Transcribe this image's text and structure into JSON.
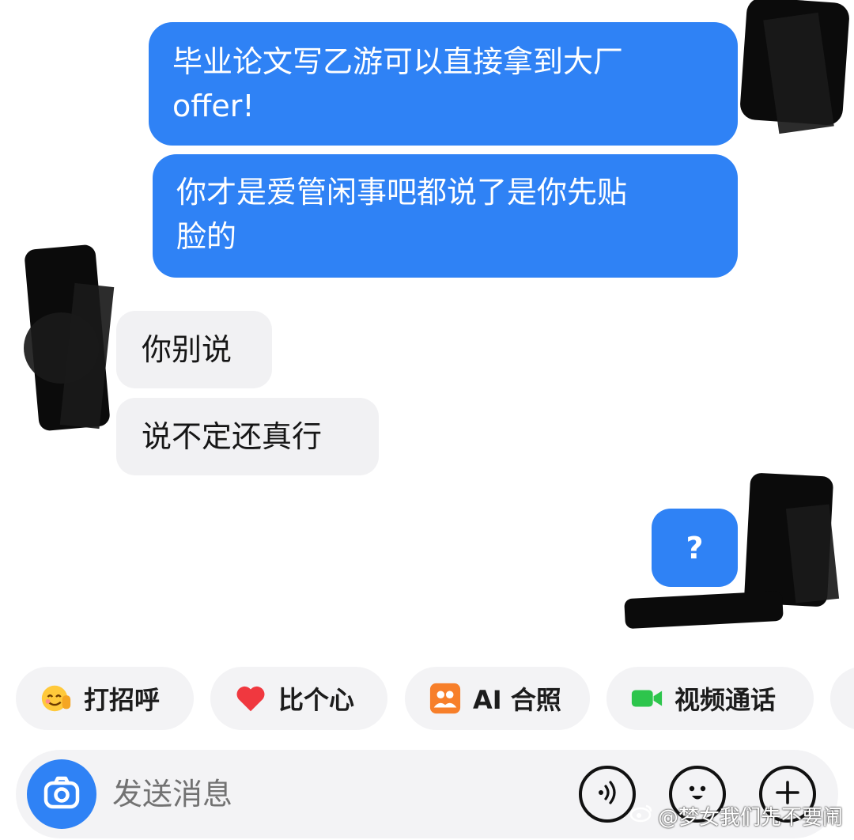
{
  "messages": [
    {
      "id": "msg1",
      "side": "sent",
      "lines": [
        "毕业论文写乙游可以直接拿到大厂",
        "offer!"
      ]
    },
    {
      "id": "msg2",
      "side": "sent",
      "lines": [
        "你才是爱管闲事吧都说了是你先贴",
        "脸的"
      ]
    },
    {
      "id": "msg3",
      "side": "received",
      "text": "你别说"
    },
    {
      "id": "msg4",
      "side": "received",
      "text": "说不定还真行"
    },
    {
      "id": "msg5",
      "side": "sent",
      "text": "?"
    }
  ],
  "quick_actions": [
    {
      "label": "打招呼",
      "icon": "wave-emoji-icon"
    },
    {
      "label": "比个心",
      "icon": "heart-icon"
    },
    {
      "label": "AI 合照",
      "icon": "ai-photo-icon"
    },
    {
      "label": "视频通话",
      "icon": "video-call-icon"
    }
  ],
  "composer": {
    "placeholder": "发送消息",
    "icons": [
      "camera-icon",
      "voice-icon",
      "emoji-icon",
      "plus-icon"
    ]
  },
  "watermark": "@梦女我们先不要闹",
  "colors": {
    "sent_bubble": "#2f82f5",
    "received_bubble": "#f1f1f3",
    "chip_bg": "#f3f3f5"
  }
}
